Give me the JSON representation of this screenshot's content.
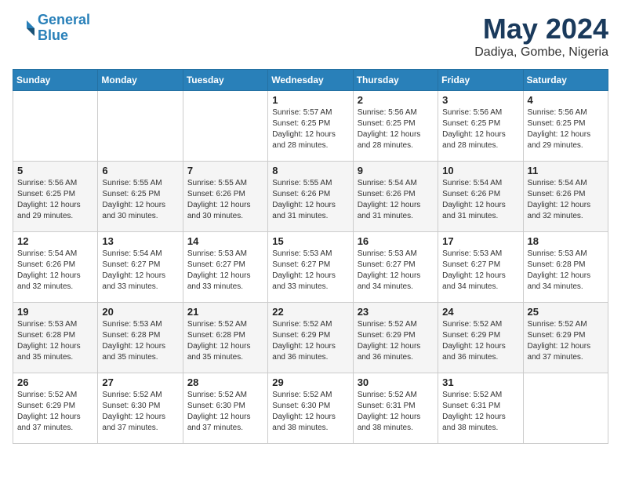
{
  "header": {
    "logo_line1": "General",
    "logo_line2": "Blue",
    "month_title": "May 2024",
    "location": "Dadiya, Gombe, Nigeria"
  },
  "weekdays": [
    "Sunday",
    "Monday",
    "Tuesday",
    "Wednesday",
    "Thursday",
    "Friday",
    "Saturday"
  ],
  "weeks": [
    [
      {
        "day": "",
        "info": ""
      },
      {
        "day": "",
        "info": ""
      },
      {
        "day": "",
        "info": ""
      },
      {
        "day": "1",
        "info": "Sunrise: 5:57 AM\nSunset: 6:25 PM\nDaylight: 12 hours\nand 28 minutes."
      },
      {
        "day": "2",
        "info": "Sunrise: 5:56 AM\nSunset: 6:25 PM\nDaylight: 12 hours\nand 28 minutes."
      },
      {
        "day": "3",
        "info": "Sunrise: 5:56 AM\nSunset: 6:25 PM\nDaylight: 12 hours\nand 28 minutes."
      },
      {
        "day": "4",
        "info": "Sunrise: 5:56 AM\nSunset: 6:25 PM\nDaylight: 12 hours\nand 29 minutes."
      }
    ],
    [
      {
        "day": "5",
        "info": "Sunrise: 5:56 AM\nSunset: 6:25 PM\nDaylight: 12 hours\nand 29 minutes."
      },
      {
        "day": "6",
        "info": "Sunrise: 5:55 AM\nSunset: 6:25 PM\nDaylight: 12 hours\nand 30 minutes."
      },
      {
        "day": "7",
        "info": "Sunrise: 5:55 AM\nSunset: 6:26 PM\nDaylight: 12 hours\nand 30 minutes."
      },
      {
        "day": "8",
        "info": "Sunrise: 5:55 AM\nSunset: 6:26 PM\nDaylight: 12 hours\nand 31 minutes."
      },
      {
        "day": "9",
        "info": "Sunrise: 5:54 AM\nSunset: 6:26 PM\nDaylight: 12 hours\nand 31 minutes."
      },
      {
        "day": "10",
        "info": "Sunrise: 5:54 AM\nSunset: 6:26 PM\nDaylight: 12 hours\nand 31 minutes."
      },
      {
        "day": "11",
        "info": "Sunrise: 5:54 AM\nSunset: 6:26 PM\nDaylight: 12 hours\nand 32 minutes."
      }
    ],
    [
      {
        "day": "12",
        "info": "Sunrise: 5:54 AM\nSunset: 6:26 PM\nDaylight: 12 hours\nand 32 minutes."
      },
      {
        "day": "13",
        "info": "Sunrise: 5:54 AM\nSunset: 6:27 PM\nDaylight: 12 hours\nand 33 minutes."
      },
      {
        "day": "14",
        "info": "Sunrise: 5:53 AM\nSunset: 6:27 PM\nDaylight: 12 hours\nand 33 minutes."
      },
      {
        "day": "15",
        "info": "Sunrise: 5:53 AM\nSunset: 6:27 PM\nDaylight: 12 hours\nand 33 minutes."
      },
      {
        "day": "16",
        "info": "Sunrise: 5:53 AM\nSunset: 6:27 PM\nDaylight: 12 hours\nand 34 minutes."
      },
      {
        "day": "17",
        "info": "Sunrise: 5:53 AM\nSunset: 6:27 PM\nDaylight: 12 hours\nand 34 minutes."
      },
      {
        "day": "18",
        "info": "Sunrise: 5:53 AM\nSunset: 6:28 PM\nDaylight: 12 hours\nand 34 minutes."
      }
    ],
    [
      {
        "day": "19",
        "info": "Sunrise: 5:53 AM\nSunset: 6:28 PM\nDaylight: 12 hours\nand 35 minutes."
      },
      {
        "day": "20",
        "info": "Sunrise: 5:53 AM\nSunset: 6:28 PM\nDaylight: 12 hours\nand 35 minutes."
      },
      {
        "day": "21",
        "info": "Sunrise: 5:52 AM\nSunset: 6:28 PM\nDaylight: 12 hours\nand 35 minutes."
      },
      {
        "day": "22",
        "info": "Sunrise: 5:52 AM\nSunset: 6:29 PM\nDaylight: 12 hours\nand 36 minutes."
      },
      {
        "day": "23",
        "info": "Sunrise: 5:52 AM\nSunset: 6:29 PM\nDaylight: 12 hours\nand 36 minutes."
      },
      {
        "day": "24",
        "info": "Sunrise: 5:52 AM\nSunset: 6:29 PM\nDaylight: 12 hours\nand 36 minutes."
      },
      {
        "day": "25",
        "info": "Sunrise: 5:52 AM\nSunset: 6:29 PM\nDaylight: 12 hours\nand 37 minutes."
      }
    ],
    [
      {
        "day": "26",
        "info": "Sunrise: 5:52 AM\nSunset: 6:29 PM\nDaylight: 12 hours\nand 37 minutes."
      },
      {
        "day": "27",
        "info": "Sunrise: 5:52 AM\nSunset: 6:30 PM\nDaylight: 12 hours\nand 37 minutes."
      },
      {
        "day": "28",
        "info": "Sunrise: 5:52 AM\nSunset: 6:30 PM\nDaylight: 12 hours\nand 37 minutes."
      },
      {
        "day": "29",
        "info": "Sunrise: 5:52 AM\nSunset: 6:30 PM\nDaylight: 12 hours\nand 38 minutes."
      },
      {
        "day": "30",
        "info": "Sunrise: 5:52 AM\nSunset: 6:31 PM\nDaylight: 12 hours\nand 38 minutes."
      },
      {
        "day": "31",
        "info": "Sunrise: 5:52 AM\nSunset: 6:31 PM\nDaylight: 12 hours\nand 38 minutes."
      },
      {
        "day": "",
        "info": ""
      }
    ]
  ]
}
